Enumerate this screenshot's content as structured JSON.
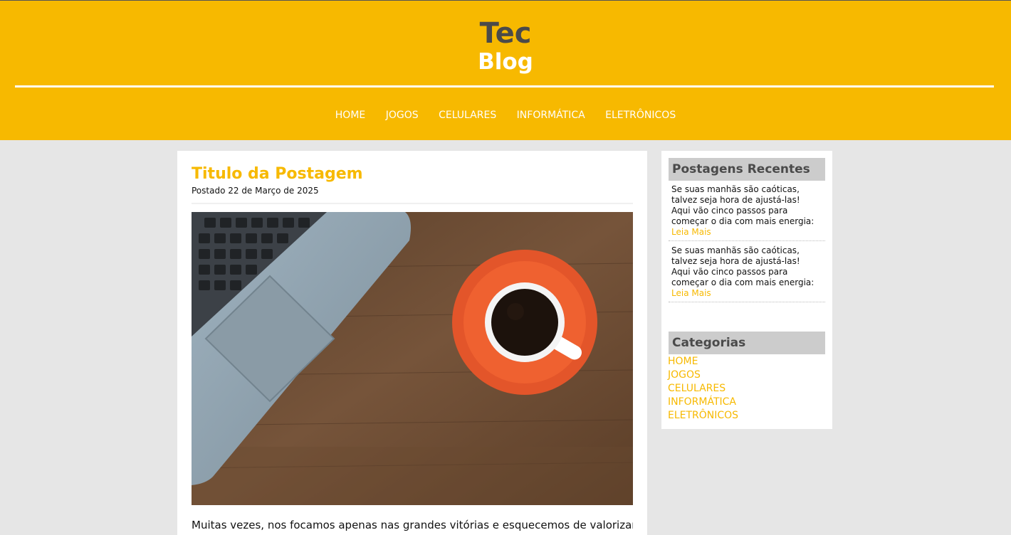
{
  "site": {
    "title_line1": "Tec",
    "title_line2": "Blog"
  },
  "nav": [
    {
      "label": "HOME"
    },
    {
      "label": "JOGOS"
    },
    {
      "label": "CELULARES"
    },
    {
      "label": "INFORMÁTICA"
    },
    {
      "label": "ELETRÔNICOS"
    }
  ],
  "post": {
    "title": "Titulo da Postagem",
    "date": "Postado 22 de Março de 2025",
    "body": "Muitas vezes, nos focamos apenas nas grandes vitórias e esquecemos de valorizar as"
  },
  "sidebar": {
    "recent_title": "Postagens Recentes",
    "recent": [
      {
        "text": "Se suas manhãs são caóticas, talvez seja hora de ajustá-las! Aqui vão cinco passos para começar o dia com mais energia:",
        "link": "Leia Mais"
      },
      {
        "text": "Se suas manhãs são caóticas, talvez seja hora de ajustá-las! Aqui vão cinco passos para começar o dia com mais energia:",
        "link": "Leia Mais"
      }
    ],
    "categories_title": "Categorias",
    "categories": [
      {
        "label": "HOME"
      },
      {
        "label": "JOGOS"
      },
      {
        "label": "CELULARES"
      },
      {
        "label": "INFORMÁTICA"
      },
      {
        "label": "ELETRÔNICOS"
      }
    ]
  },
  "colors": {
    "accent": "#f7b900",
    "page_bg": "#e6e6e6",
    "widget_header": "#cccccc"
  }
}
